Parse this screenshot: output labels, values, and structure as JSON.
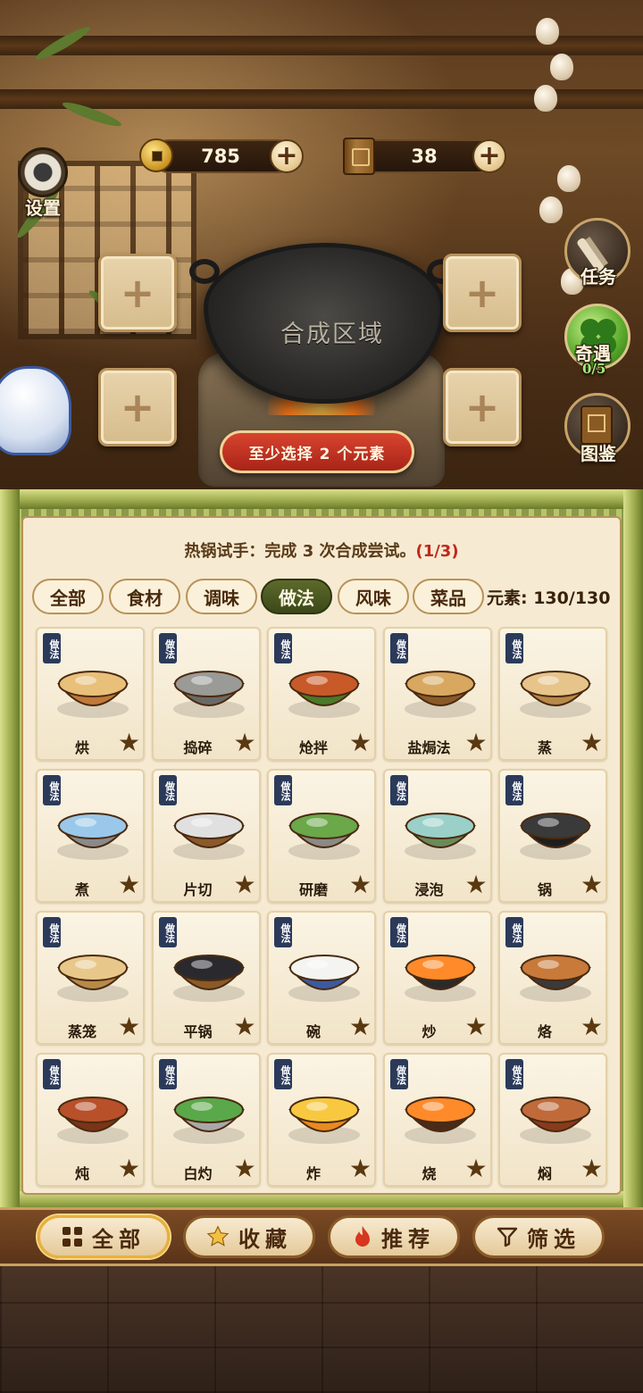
{
  "hud": {
    "coins": "785",
    "books": "38",
    "settings_label": "设置"
  },
  "synthesis": {
    "area_label": "合成区域",
    "warning": "至少选择 2 个元素",
    "slots": [
      "+",
      "+",
      "+",
      "+"
    ]
  },
  "side_menu": {
    "task_label": "任务",
    "encounter_label": "奇遇",
    "encounter_progress": "0/5",
    "catalog_label": "图鉴"
  },
  "quest": {
    "text": "热锅试手：完成 3 次合成尝试。",
    "progress": "(1/3)"
  },
  "tabs": [
    {
      "label": "全部",
      "active": false
    },
    {
      "label": "食材",
      "active": false
    },
    {
      "label": "调味",
      "active": false
    },
    {
      "label": "做法",
      "active": true
    },
    {
      "label": "风味",
      "active": false
    },
    {
      "label": "菜品",
      "active": false
    }
  ],
  "element_count": "元素: 130/130",
  "card_tag": "做法",
  "cards": [
    {
      "name": "烘",
      "icon": "oven-icon"
    },
    {
      "name": "捣碎",
      "icon": "mortar-icon"
    },
    {
      "name": "炝拌",
      "icon": "salad-bowl-icon"
    },
    {
      "name": "盐焗法",
      "icon": "salt-baked-chicken-icon"
    },
    {
      "name": "蒸",
      "icon": "steamer-icon"
    },
    {
      "name": "煮",
      "icon": "boiling-pot-icon"
    },
    {
      "name": "片切",
      "icon": "knife-icon"
    },
    {
      "name": "研磨",
      "icon": "grinding-mortar-icon"
    },
    {
      "name": "浸泡",
      "icon": "soaking-bowl-icon"
    },
    {
      "name": "锅",
      "icon": "wok-icon"
    },
    {
      "name": "蒸笼",
      "icon": "bamboo-steamer-icon"
    },
    {
      "name": "平锅",
      "icon": "frying-pan-icon"
    },
    {
      "name": "碗",
      "icon": "bowl-icon"
    },
    {
      "name": "炒",
      "icon": "stir-fry-icon"
    },
    {
      "name": "烙",
      "icon": "griddle-icon"
    },
    {
      "name": "炖",
      "icon": "stew-pot-icon"
    },
    {
      "name": "白灼",
      "icon": "blanching-pot-icon"
    },
    {
      "name": "炸",
      "icon": "deep-fry-icon"
    },
    {
      "name": "烧",
      "icon": "grill-icon"
    },
    {
      "name": "焖",
      "icon": "clay-pot-icon"
    }
  ],
  "bottom_nav": {
    "all": "全部",
    "favorites": "收藏",
    "recommend": "推荐",
    "filter": "筛选"
  },
  "colors": {
    "accent_red": "#c0281c",
    "active_tab": "#4c5a22",
    "panel": "#f6ead2"
  }
}
